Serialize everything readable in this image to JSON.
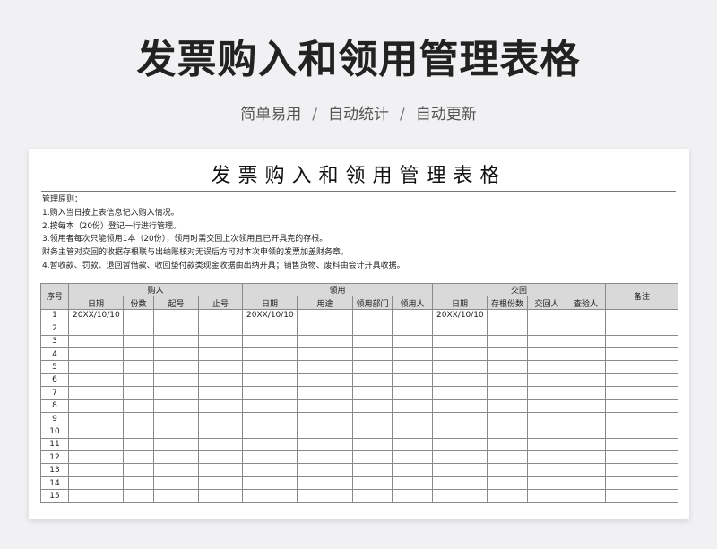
{
  "hero": {
    "title": "发票购入和领用管理表格",
    "sub_items": [
      "简单易用",
      "自动统计",
      "自动更新"
    ],
    "separator": "/"
  },
  "sheet": {
    "title": "发票购入和领用管理表格",
    "rules": [
      "管理原则：",
      "1.购入当日按上表信息记入购入情况。",
      "2.按每本（20份）登记一行进行管理。",
      "3.领用者每次只能领用1本（20份），领用时需交回上次领用且已开具完的存根。",
      "财务主管对交回的收据存根联与出纳账核对无误后方可对本次申领的发票加盖财务章。",
      "4.暂收款、罚款、退回暂借款、收回垫付款类现金收据由出纳开具；销售货物、废料由会计开具收据。"
    ],
    "table": {
      "seq_header": "序号",
      "note_header": "备注",
      "groups": [
        {
          "label": "购入",
          "columns": [
            "日期",
            "份数",
            "起号",
            "止号"
          ]
        },
        {
          "label": "领用",
          "columns": [
            "日期",
            "用途",
            "领用部门",
            "领用人"
          ]
        },
        {
          "label": "交回",
          "columns": [
            "日期",
            "存根份数",
            "交回人",
            "查验人"
          ]
        }
      ],
      "rows": [
        {
          "no": "1",
          "cells": [
            "20XX/10/10",
            "",
            "",
            "",
            "20XX/10/10",
            "",
            "",
            "",
            "20XX/10/10",
            "",
            "",
            ""
          ],
          "note": ""
        },
        {
          "no": "2",
          "cells": [
            "",
            "",
            "",
            "",
            "",
            "",
            "",
            "",
            "",
            "",
            "",
            ""
          ],
          "note": ""
        },
        {
          "no": "3",
          "cells": [
            "",
            "",
            "",
            "",
            "",
            "",
            "",
            "",
            "",
            "",
            "",
            ""
          ],
          "note": ""
        },
        {
          "no": "4",
          "cells": [
            "",
            "",
            "",
            "",
            "",
            "",
            "",
            "",
            "",
            "",
            "",
            ""
          ],
          "note": ""
        },
        {
          "no": "5",
          "cells": [
            "",
            "",
            "",
            "",
            "",
            "",
            "",
            "",
            "",
            "",
            "",
            ""
          ],
          "note": ""
        },
        {
          "no": "6",
          "cells": [
            "",
            "",
            "",
            "",
            "",
            "",
            "",
            "",
            "",
            "",
            "",
            ""
          ],
          "note": ""
        },
        {
          "no": "7",
          "cells": [
            "",
            "",
            "",
            "",
            "",
            "",
            "",
            "",
            "",
            "",
            "",
            ""
          ],
          "note": ""
        },
        {
          "no": "8",
          "cells": [
            "",
            "",
            "",
            "",
            "",
            "",
            "",
            "",
            "",
            "",
            "",
            ""
          ],
          "note": ""
        },
        {
          "no": "9",
          "cells": [
            "",
            "",
            "",
            "",
            "",
            "",
            "",
            "",
            "",
            "",
            "",
            ""
          ],
          "note": ""
        },
        {
          "no": "10",
          "cells": [
            "",
            "",
            "",
            "",
            "",
            "",
            "",
            "",
            "",
            "",
            "",
            ""
          ],
          "note": ""
        },
        {
          "no": "11",
          "cells": [
            "",
            "",
            "",
            "",
            "",
            "",
            "",
            "",
            "",
            "",
            "",
            ""
          ],
          "note": ""
        },
        {
          "no": "12",
          "cells": [
            "",
            "",
            "",
            "",
            "",
            "",
            "",
            "",
            "",
            "",
            "",
            ""
          ],
          "note": ""
        },
        {
          "no": "13",
          "cells": [
            "",
            "",
            "",
            "",
            "",
            "",
            "",
            "",
            "",
            "",
            "",
            ""
          ],
          "note": ""
        },
        {
          "no": "14",
          "cells": [
            "",
            "",
            "",
            "",
            "",
            "",
            "",
            "",
            "",
            "",
            "",
            ""
          ],
          "note": ""
        },
        {
          "no": "15",
          "cells": [
            "",
            "",
            "",
            "",
            "",
            "",
            "",
            "",
            "",
            "",
            "",
            ""
          ],
          "note": ""
        }
      ]
    }
  }
}
